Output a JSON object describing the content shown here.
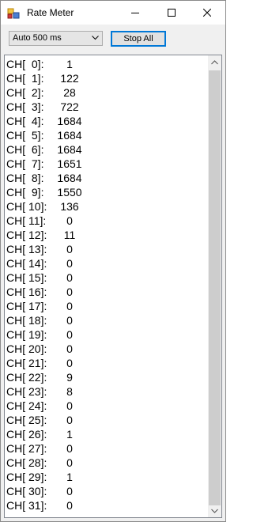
{
  "window": {
    "title": "Rate Meter"
  },
  "toolbar": {
    "interval_value": "Auto 500 ms",
    "stop_all_label": "Stop All"
  },
  "channels": [
    {
      "label": "CH[  0]:",
      "value": "1"
    },
    {
      "label": "CH[  1]:",
      "value": "122"
    },
    {
      "label": "CH[  2]:",
      "value": "28"
    },
    {
      "label": "CH[  3]:",
      "value": "722"
    },
    {
      "label": "CH[  4]:",
      "value": "1684"
    },
    {
      "label": "CH[  5]:",
      "value": "1684"
    },
    {
      "label": "CH[  6]:",
      "value": "1684"
    },
    {
      "label": "CH[  7]:",
      "value": "1651"
    },
    {
      "label": "CH[  8]:",
      "value": "1684"
    },
    {
      "label": "CH[  9]:",
      "value": "1550"
    },
    {
      "label": "CH[ 10]:",
      "value": "136"
    },
    {
      "label": "CH[ 11]:",
      "value": "0"
    },
    {
      "label": "CH[ 12]:",
      "value": "11"
    },
    {
      "label": "CH[ 13]:",
      "value": "0"
    },
    {
      "label": "CH[ 14]:",
      "value": "0"
    },
    {
      "label": "CH[ 15]:",
      "value": "0"
    },
    {
      "label": "CH[ 16]:",
      "value": "0"
    },
    {
      "label": "CH[ 17]:",
      "value": "0"
    },
    {
      "label": "CH[ 18]:",
      "value": "0"
    },
    {
      "label": "CH[ 19]:",
      "value": "0"
    },
    {
      "label": "CH[ 20]:",
      "value": "0"
    },
    {
      "label": "CH[ 21]:",
      "value": "0"
    },
    {
      "label": "CH[ 22]:",
      "value": "9"
    },
    {
      "label": "CH[ 23]:",
      "value": "8"
    },
    {
      "label": "CH[ 24]:",
      "value": "0"
    },
    {
      "label": "CH[ 25]:",
      "value": "0"
    },
    {
      "label": "CH[ 26]:",
      "value": "1"
    },
    {
      "label": "CH[ 27]:",
      "value": "0"
    },
    {
      "label": "CH[ 28]:",
      "value": "0"
    },
    {
      "label": "CH[ 29]:",
      "value": "1"
    },
    {
      "label": "CH[ 30]:",
      "value": "0"
    },
    {
      "label": "CH[ 31]:",
      "value": "0"
    }
  ]
}
